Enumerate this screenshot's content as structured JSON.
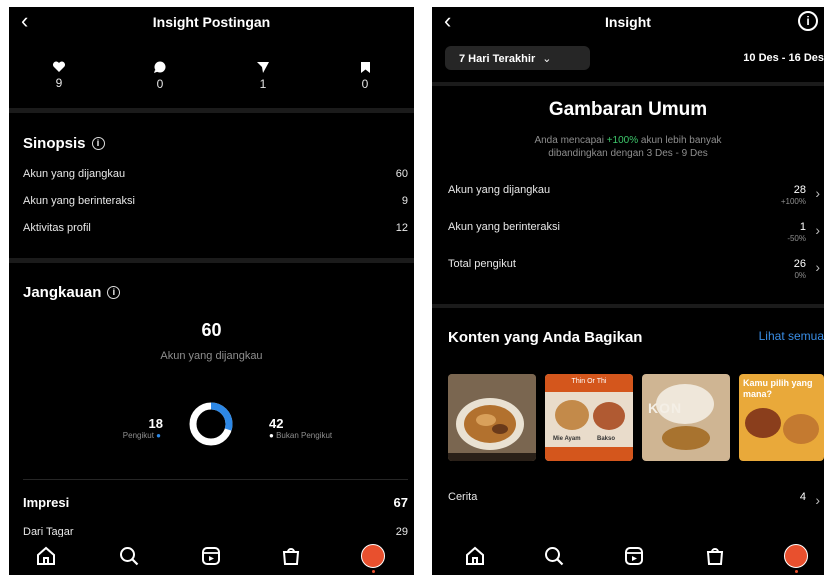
{
  "left": {
    "title": "Insight Postingan",
    "stats": [
      {
        "icon": "heart-icon",
        "value": "9"
      },
      {
        "icon": "comment-icon",
        "value": "0"
      },
      {
        "icon": "send-icon",
        "value": "1"
      },
      {
        "icon": "bookmark-icon",
        "value": "0"
      }
    ],
    "synopsis": {
      "title": "Sinopsis",
      "rows": [
        {
          "label": "Akun yang dijangkau",
          "value": "60"
        },
        {
          "label": "Akun yang berinteraksi",
          "value": "9"
        },
        {
          "label": "Aktivitas profil",
          "value": "12"
        }
      ]
    },
    "reach": {
      "title": "Jangkauan",
      "total": "60",
      "total_label": "Akun yang dijangkau",
      "followers_value": "18",
      "followers_label": "Pengikut",
      "nonfollowers_value": "42",
      "nonfollowers_label": "Bukan Pengikut",
      "followers_fraction": 0.3
    },
    "impressions": {
      "label": "Impresi",
      "value": "67"
    },
    "from_tags": {
      "label": "Dari Tagar",
      "value": "29"
    }
  },
  "right": {
    "title": "Insight",
    "dropdown": "7 Hari Terakhir",
    "date_range": "10 Des - 16 Des",
    "overview_title": "Gambaran Umum",
    "subtitle_pre": "Anda mencapai ",
    "subtitle_pct": "+100%",
    "subtitle_post": " akun lebih banyak",
    "subtitle_line2": "dibandingkan dengan 3 Des - 9 Des",
    "metrics": [
      {
        "label": "Akun yang dijangkau",
        "value": "28",
        "change": "+100%"
      },
      {
        "label": "Akun yang berinteraksi",
        "value": "1",
        "change": "-50%"
      },
      {
        "label": "Total pengikut",
        "value": "26",
        "change": "0%"
      }
    ],
    "content_title": "Konten yang Anda Bagikan",
    "see_all": "Lihat semua",
    "thumb_texts": [
      "Thin Or Thi",
      "Mie Ayam",
      "Bakso",
      "KON",
      "Kamu pilih yang mana?"
    ],
    "stories": {
      "label": "Cerita",
      "value": "4"
    }
  },
  "colors": {
    "accent_blue": "#3a8ee6",
    "positive_green": "#3ec76b",
    "donut_blue": "#2d88e6"
  },
  "nav_icons": [
    "home-icon",
    "search-icon",
    "reels-icon",
    "shop-icon",
    "profile-avatar"
  ]
}
